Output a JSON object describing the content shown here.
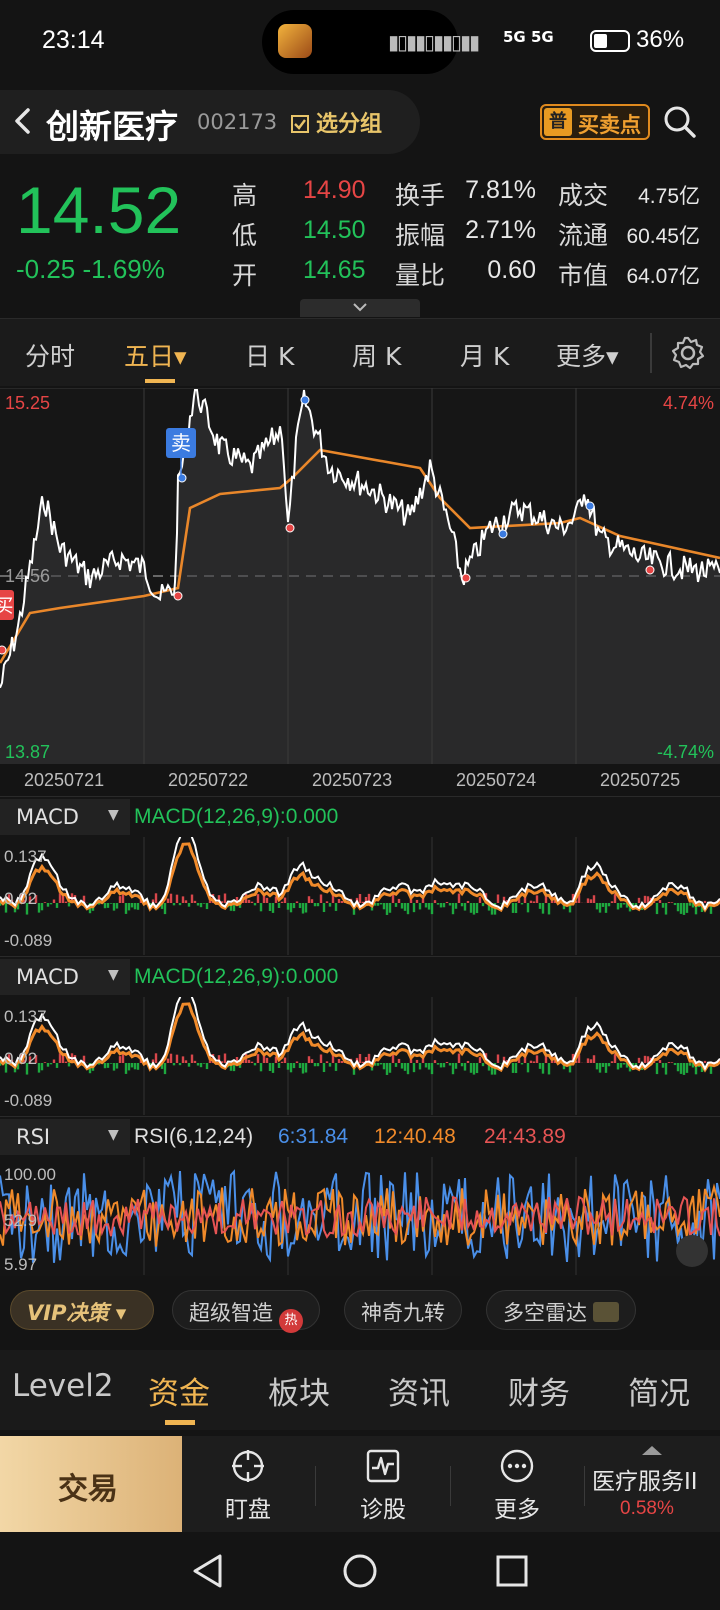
{
  "status_bar": {
    "time": "23:14",
    "signal": "5G 5G",
    "battery": "36%"
  },
  "header": {
    "stock_name": "创新医疗",
    "stock_code": "002173",
    "group_button": "选分组",
    "bs_badge": "普",
    "bs_button": "买卖点"
  },
  "quote": {
    "price": "14.52",
    "change": "-0.25 -1.69%",
    "stats": [
      {
        "label": "高",
        "value": "14.90",
        "color": "#e64545"
      },
      {
        "label": "低",
        "value": "14.50",
        "color": "#22c25a"
      },
      {
        "label": "开",
        "value": "14.65",
        "color": "#22c25a"
      }
    ],
    "metrics": [
      {
        "label": "换手",
        "value": "7.81%"
      },
      {
        "label": "振幅",
        "value": "2.71%"
      },
      {
        "label": "量比",
        "value": "0.60"
      }
    ],
    "values": [
      {
        "label": "成交",
        "value": "4.75亿"
      },
      {
        "label": "流通",
        "value": "60.45亿"
      },
      {
        "label": "市值",
        "value": "64.07亿"
      }
    ]
  },
  "period_tabs": [
    "分时",
    "五日▾",
    "日 K",
    "周 K",
    "月 K",
    "更多▾"
  ],
  "main_chart": {
    "high_label": "15.25",
    "low_label": "13.87",
    "ref_label": "14.56",
    "high_pct": "4.74%",
    "low_pct": "-4.74%",
    "sell_marker": "卖",
    "buy_marker": "买",
    "dates": [
      "20250721",
      "20250722",
      "20250723",
      "20250724",
      "20250725"
    ],
    "colors": {
      "price": "#ffffff",
      "avg": "#e9872a",
      "up": "#e64545",
      "down": "#22c25a"
    }
  },
  "macd1": {
    "name": "MACD",
    "params": "MACD(12,26,9):0.000",
    "top": "0.137",
    "mid": "0.02",
    "bottom": "-0.089"
  },
  "macd2": {
    "name": "MACD",
    "params": "MACD(12,26,9):0.000",
    "top": "0.137",
    "mid": "0.02",
    "bottom": "-0.089"
  },
  "rsi": {
    "name": "RSI",
    "params": "RSI(6,12,24)",
    "rsi6": "6:31.84",
    "rsi12": "12:40.48",
    "rsi24": "24:43.89",
    "top": "100.00",
    "mid": "52.9",
    "bottom": "5.97"
  },
  "feature_strip": {
    "vip": "VIP决策 ▾",
    "chips": [
      "超级智造",
      "神奇九转",
      "多空雷达"
    ],
    "hot_badge": "热"
  },
  "info_tabs": [
    "Level2",
    "资金",
    "板块",
    "资讯",
    "财务",
    "简况"
  ],
  "action_bar": {
    "trade": "交易",
    "items": [
      "盯盘",
      "诊股",
      "更多"
    ],
    "sector_name": "医疗服务II",
    "sector_pct": "0.58%"
  }
}
